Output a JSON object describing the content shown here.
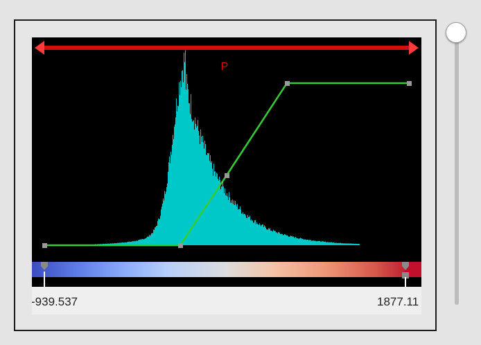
{
  "editor": {
    "range_arrow_label": "P",
    "range_min_label": "-939.537",
    "range_max_label": "1877.11"
  },
  "colors": {
    "histogram": "#00c8c8",
    "transfer_line": "#33cc33",
    "range_arrow": "#d01010",
    "colormap": "coolwarm"
  }
}
